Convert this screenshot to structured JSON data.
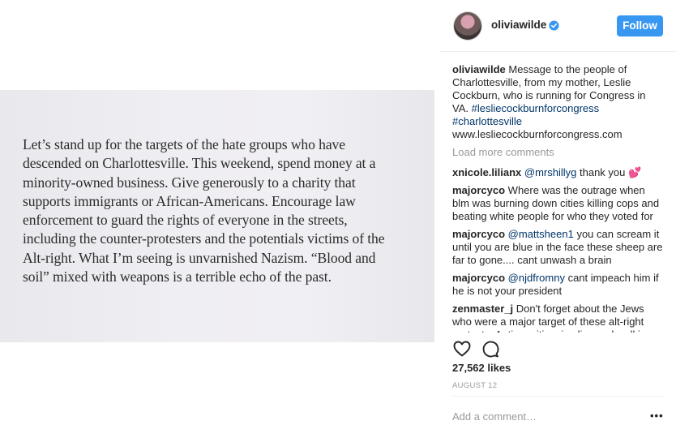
{
  "photo": {
    "lines": [
      "Let’s stand up for the targets of the hate groups who have",
      "descended on Charlottesville. This weekend, spend money at a",
      "minority-owned business. Give generously to a charity that",
      "supports immigrants or African-Americans. Encourage law",
      "enforcement to guard the rights of everyone in the streets,",
      "including the counter-protesters and the potentials victims of the",
      "Alt-right. What I’m seeing is unvarnished Nazism. “Blood and",
      "soil” mixed with weapons is a terrible echo of the past."
    ]
  },
  "header": {
    "username": "oliviawilde",
    "follow_label": "Follow",
    "verified_icon": "verified-badge-icon",
    "accent_color": "#3897f0"
  },
  "caption": {
    "username": "oliviawilde",
    "text": "Message to the people of Charlottesville, from my mother, Leslie Cockburn, who is running for Congress in VA.",
    "tag1": "#lesliecockburnforcongress",
    "tag2": "#charlottesville",
    "link": "www.lesliecockburnforcongress.com"
  },
  "load_more": "Load more comments",
  "comments": [
    {
      "user": "xnicole.lilianx",
      "mention": "@mrshillyg",
      "text": "thank you 💕"
    },
    {
      "user": "majorcyco",
      "mention": "",
      "text": "Where was the outrage when blm was burning down cities killing cops and beating white people for who they voted for"
    },
    {
      "user": "majorcyco",
      "mention": "@mattsheen1",
      "text": "you can scream it until you are blue in the face these sheep are far to gone.... cant unwash a brain"
    },
    {
      "user": "majorcyco",
      "mention": "@njdfromny",
      "text": "cant impeach him if he is not your president"
    },
    {
      "user": "zenmaster_j",
      "mention": "",
      "text": "Don't forget about the Jews who were a major target of these alt-right protests. Anti-semitism is alive and well in"
    }
  ],
  "likes": "27,562 likes",
  "date": "AUGUST 12",
  "add_comment_placeholder": "Add a comment…",
  "more_label": "•••"
}
